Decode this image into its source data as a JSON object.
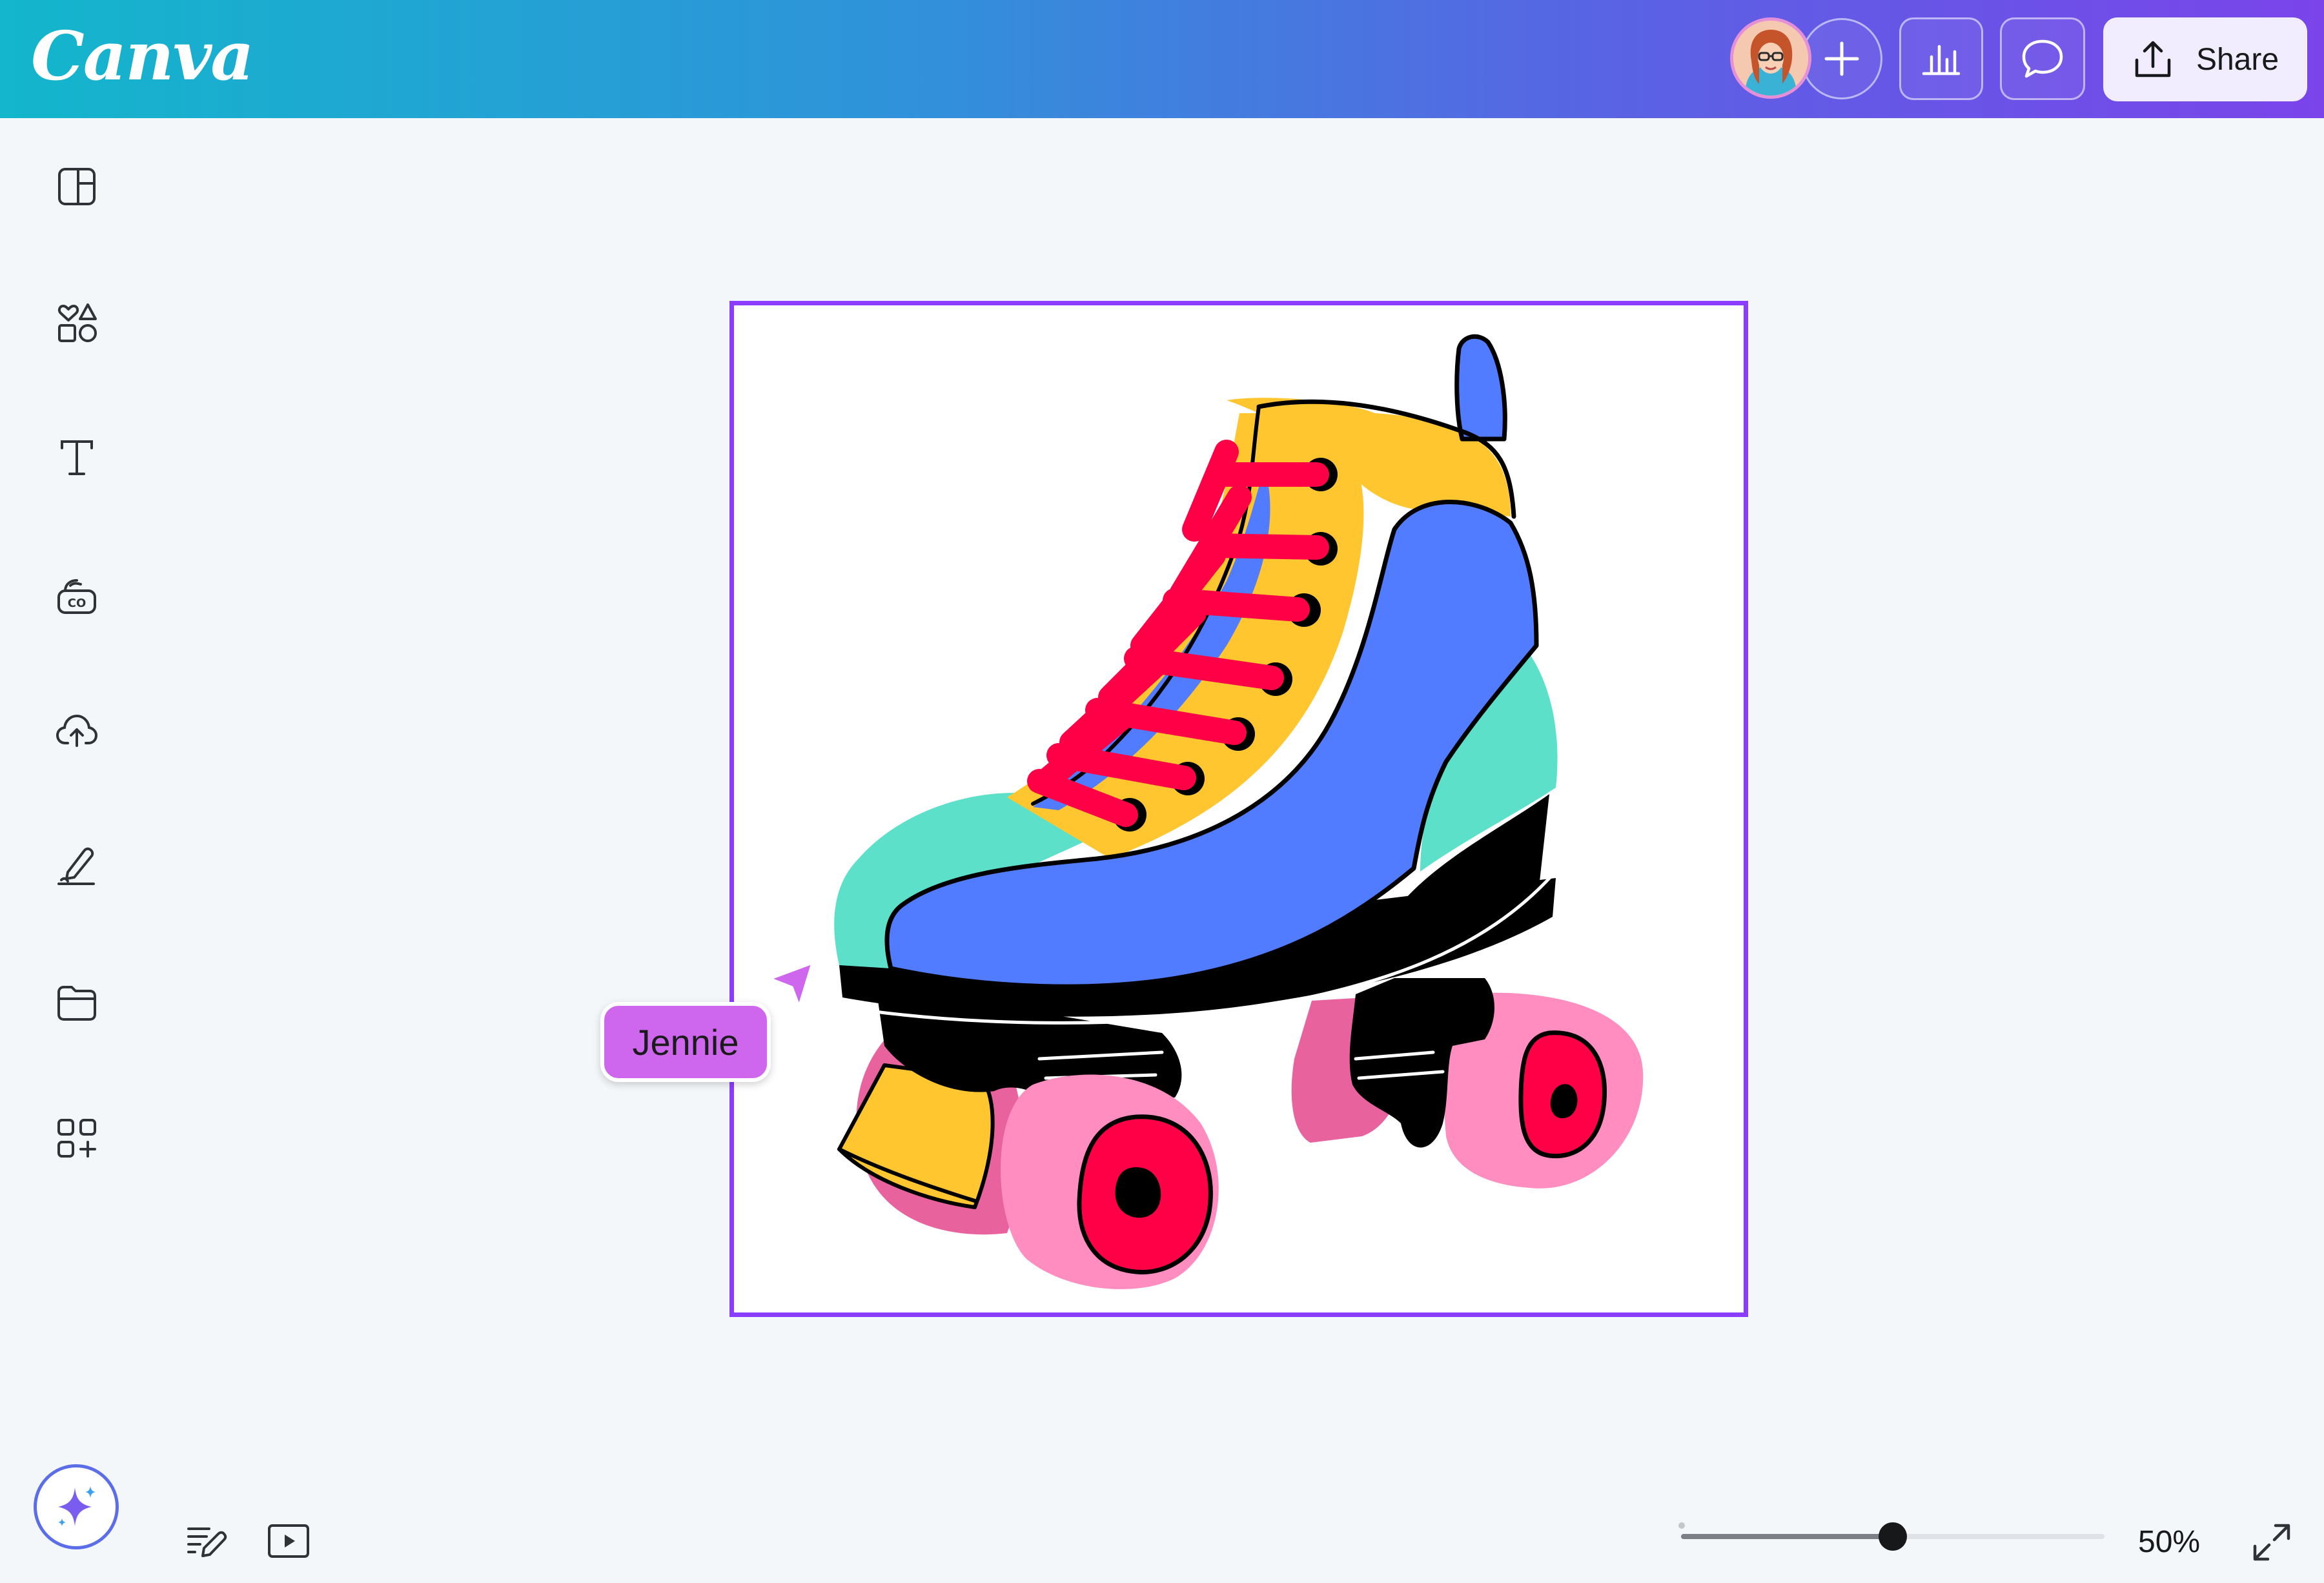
{
  "app": {
    "logo": "Canva"
  },
  "header": {
    "share_label": "Share",
    "colors": {
      "gradient_start": "#13b6cc",
      "gradient_end": "#7a44ea",
      "share_bg": "#f1ecfe"
    },
    "icons": [
      "user-avatar",
      "plus-icon",
      "insights-chart-icon",
      "comment-icon",
      "share-upload-icon"
    ]
  },
  "sidebar": {
    "items": [
      {
        "name": "design",
        "icon": "layout-panel-icon"
      },
      {
        "name": "elements",
        "icon": "shapes-icon"
      },
      {
        "name": "text",
        "icon": "text-icon"
      },
      {
        "name": "brand",
        "icon": "brand-kit-icon"
      },
      {
        "name": "uploads",
        "icon": "cloud-upload-icon"
      },
      {
        "name": "draw",
        "icon": "pen-draw-icon"
      },
      {
        "name": "projects",
        "icon": "folder-icon"
      },
      {
        "name": "apps",
        "icon": "apps-grid-icon"
      }
    ]
  },
  "canvas": {
    "selection_color": "#8b3dff",
    "collaborator": {
      "name": "Jennie",
      "color": "#cf66ee"
    },
    "skate_colors": {
      "boot": "#517cff",
      "toe": "#5de0c9",
      "tongue": "#ffc630",
      "laces": "#ff0047",
      "wheels": "#ff8dbf",
      "hubs": "#ff0047"
    }
  },
  "footer": {
    "zoom": {
      "label": "50%",
      "fraction": 0.5
    },
    "icons": [
      "magic-sparkle-icon",
      "notes-icon",
      "present-icon",
      "fullscreen-icon"
    ]
  }
}
